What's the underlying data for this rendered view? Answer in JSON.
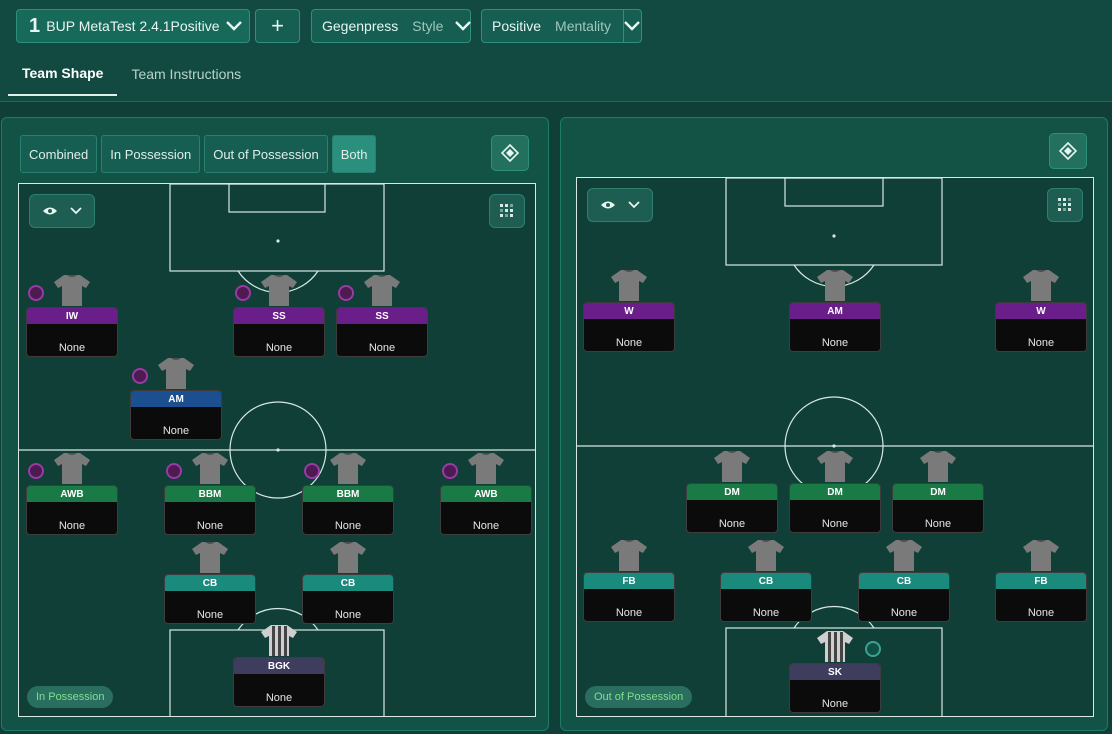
{
  "header": {
    "tactic_number": "1",
    "tactic_name": "BUP MetaTest 2.4.1Positive",
    "add_label": "+",
    "style_value": "Gegenpress",
    "style_key": "Style",
    "mentality_value": "Positive",
    "mentality_key": "Mentality",
    "tabs": [
      {
        "label": "Team Shape"
      },
      {
        "label": "Team Instructions"
      }
    ]
  },
  "left_panel": {
    "segments": [
      "Combined",
      "In Possession",
      "Out of Possession",
      "Both"
    ],
    "phase_label": "In Possession",
    "players": [
      {
        "role": "IW",
        "name": "None"
      },
      {
        "role": "SS",
        "name": "None"
      },
      {
        "role": "SS",
        "name": "None"
      },
      {
        "role": "AM",
        "name": "None"
      },
      {
        "role": "AWB",
        "name": "None"
      },
      {
        "role": "BBM",
        "name": "None"
      },
      {
        "role": "BBM",
        "name": "None"
      },
      {
        "role": "AWB",
        "name": "None"
      },
      {
        "role": "CB",
        "name": "None"
      },
      {
        "role": "CB",
        "name": "None"
      },
      {
        "role": "BGK",
        "name": "None"
      }
    ]
  },
  "right_panel": {
    "phase_label": "Out of Possession",
    "players": [
      {
        "role": "W",
        "name": "None"
      },
      {
        "role": "AM",
        "name": "None"
      },
      {
        "role": "W",
        "name": "None"
      },
      {
        "role": "DM",
        "name": "None"
      },
      {
        "role": "DM",
        "name": "None"
      },
      {
        "role": "DM",
        "name": "None"
      },
      {
        "role": "FB",
        "name": "None"
      },
      {
        "role": "CB",
        "name": "None"
      },
      {
        "role": "CB",
        "name": "None"
      },
      {
        "role": "FB",
        "name": "None"
      },
      {
        "role": "SK",
        "name": "None"
      }
    ]
  },
  "colors": {
    "background": "#0f3f37",
    "panel": "#135345",
    "attacker_role": "#6a1e8a",
    "attacking_mid_role": "#1b4f8f",
    "midfield_role": "#1a7a45",
    "defender_role": "#1a8a7c",
    "goalkeeper_role": "#3e3d5e",
    "phase_badge_text": "#7ee08e"
  },
  "icons": [
    "chevron-down-icon",
    "plus-icon",
    "tactics-board-icon",
    "eye-icon",
    "grid-icon",
    "shirt-icon"
  ]
}
